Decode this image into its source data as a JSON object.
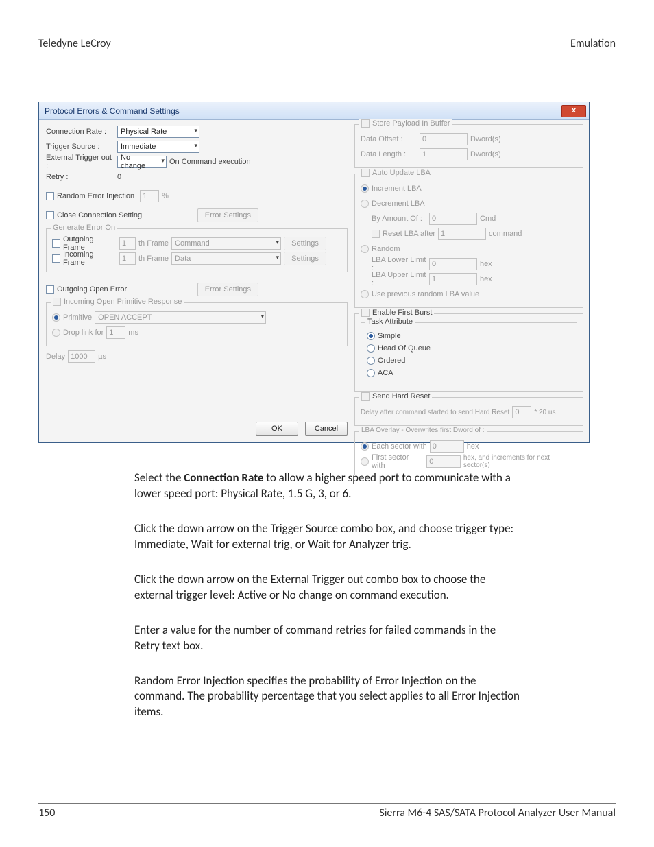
{
  "doc": {
    "header_left": "Teledyne LeCroy",
    "header_right": "Emulation",
    "page_number": "150",
    "footer_right": "Sierra M6-4 SAS/SATA Protocol Analyzer User Manual",
    "para1_pre": "Select the ",
    "para1_bold": "Connection Rate",
    "para1_post": " to allow a higher speed port to communicate with a lower speed port: Physical Rate, 1.5 G, 3, or 6.",
    "para2": "Click the down arrow on the Trigger Source combo box, and choose trigger type: Immediate, Wait for external trig, or Wait for Analyzer trig.",
    "para3": "Click the down arrow on the External Trigger out combo box to choose the external trigger level: Active or No change on command execution.",
    "para4": "Enter a value for the number of command retries for failed commands in the Retry text box.",
    "para5": "Random Error Injection specifies the probability of Error Injection on the command. The probability percentage that you select applies to all Error Injection items."
  },
  "dlg": {
    "title": "Protocol Errors & Command Settings",
    "close": "x",
    "left": {
      "conn_rate_lbl": "Connection Rate :",
      "conn_rate_val": "Physical Rate",
      "trig_src_lbl": "Trigger Source :",
      "trig_src_val": "Immediate",
      "ext_trig_lbl": "External Trigger out :",
      "ext_trig_val": "No change",
      "ext_trig_suffix": "On Command execution",
      "retry_lbl": "Retry :",
      "retry_val": "0",
      "rand_err_lbl": "Random Error Injection",
      "rand_err_val": "1",
      "rand_err_unit": "%",
      "close_conn_lbl": "Close Connection Setting",
      "err_settings_btn": "Error Settings",
      "gen_err_grp": "Generate Error On",
      "out_frame_lbl": "Outgoing Frame",
      "out_frame_num": "1",
      "th_frame": "th Frame",
      "out_frame_sel": "Command",
      "settings_btn": "Settings",
      "in_frame_lbl": "Incoming Frame",
      "in_frame_num": "1",
      "in_frame_sel": "Data",
      "out_open_err_lbl": "Outgoing Open Error",
      "inc_open_grp": "Incoming Open Primitive Response",
      "prim_lbl": "Primitive",
      "prim_val": "OPEN ACCEPT",
      "drop_link_lbl": "Drop link for",
      "drop_link_val": "1",
      "drop_link_unit": "ms",
      "delay_lbl": "Delay",
      "delay_val": "1000",
      "delay_unit": "µs",
      "ok": "OK",
      "cancel": "Cancel"
    },
    "right": {
      "store_payload": "Store Payload In Buffer",
      "data_offset_lbl": "Data Offset :",
      "data_offset_val": "0",
      "data_offset_unit": "Dword(s)",
      "data_len_lbl": "Data Length :",
      "data_len_val": "1",
      "data_len_unit": "Dword(s)",
      "auto_lba": "Auto Update LBA",
      "inc_lba": "Increment LBA",
      "dec_lba": "Decrement LBA",
      "by_amount_lbl": "By Amount Of :",
      "by_amount_val": "0",
      "by_amount_unit": "Cmd",
      "reset_lba_lbl": "Reset LBA after",
      "reset_lba_val": "1",
      "reset_lba_unit": "command",
      "random_lbl": "Random",
      "lba_lower_lbl": "LBA Lower Limit :",
      "lba_lower_val": "0",
      "lba_upper_lbl": "LBA Upper Limit :",
      "lba_upper_val": "1",
      "hex_unit": "hex",
      "use_prev": "Use previous random LBA value",
      "enable_first": "Enable First Burst",
      "task_attr": "Task Attribute",
      "simple": "Simple",
      "headq": "Head Of Queue",
      "ordered": "Ordered",
      "aca": "ACA",
      "send_hard": "Send Hard Reset",
      "hard_delay_lbl": "Delay after command started to send Hard Reset",
      "hard_delay_val": "0",
      "hard_delay_unit": "* 20 us",
      "lba_overlay": "LBA Overlay - Overwrites first Dword of :",
      "each_sector": "Each sector with",
      "each_val": "0",
      "first_sector": "First sector with",
      "first_val": "0",
      "first_suffix": "hex, and increments for next sector(s)"
    }
  }
}
